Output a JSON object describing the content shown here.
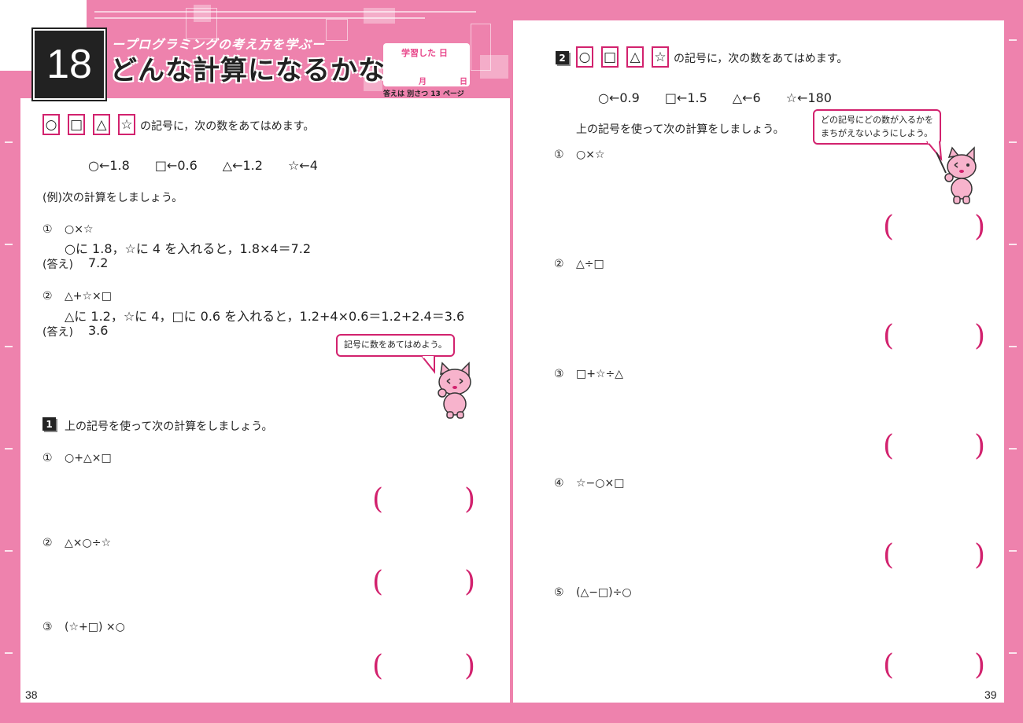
{
  "header": {
    "lesson_number": "18",
    "subtitle": "ープログラミングの考え方を学ぶー",
    "title": "どんな計算になるかな?",
    "date_label": "学習した 日",
    "month_label": "月",
    "day_label": "日",
    "answer_ref": "答えは 別さつ 13 ページ"
  },
  "colors": {
    "accent": "#ee82ad",
    "frame": "#d2226e",
    "dark": "#222222"
  },
  "left": {
    "symbols": [
      "○",
      "□",
      "△",
      "☆"
    ],
    "intro": "の記号に，次の数をあてはめます。",
    "assignments": "○←1.8　　□←0.6　　△←1.2　　☆←4",
    "example_title": "(例)次の計算をしましょう。",
    "ex1_num": "①",
    "ex1_expr": "○×☆",
    "ex1_work": "○に 1.8，☆に 4 を入れると，1.8×4＝7.2",
    "ex1_answer_label": "(答え)",
    "ex1_answer": "7.2",
    "ex2_num": "②",
    "ex2_expr": "△+☆×□",
    "ex2_work": "△に 1.2，☆に 4，□に 0.6 を入れると，1.2+4×0.6＝1.2+2.4＝3.6",
    "ex2_answer_label": "(答え)",
    "ex2_answer": "3.6",
    "bubble": "記号に数をあてはめよう。",
    "q_number": "1",
    "q_title": "上の記号を使って次の計算をしましょう。",
    "items": [
      {
        "num": "①",
        "expr": "○+△×□"
      },
      {
        "num": "②",
        "expr": "△×○÷☆"
      },
      {
        "num": "③",
        "expr": "(☆+□) ×○"
      }
    ],
    "page_number": "38"
  },
  "right": {
    "q_number": "2",
    "symbols": [
      "○",
      "□",
      "△",
      "☆"
    ],
    "intro": "の記号に，次の数をあてはめます。",
    "assignments": "○←0.9　　□←1.5　　△←6　　☆←180",
    "instruction": "上の記号を使って次の計算をしましょう。",
    "bubble": "どの記号にどの数が入るかを\nまちがえないようにしよう。",
    "items": [
      {
        "num": "①",
        "expr": "○×☆"
      },
      {
        "num": "②",
        "expr": "△÷□"
      },
      {
        "num": "③",
        "expr": "□+☆÷△"
      },
      {
        "num": "④",
        "expr": "☆−○×□"
      },
      {
        "num": "⑤",
        "expr": "(△−□)÷○"
      }
    ],
    "page_number": "39"
  },
  "answer_parens": {
    "open": "(",
    "close": ")"
  }
}
